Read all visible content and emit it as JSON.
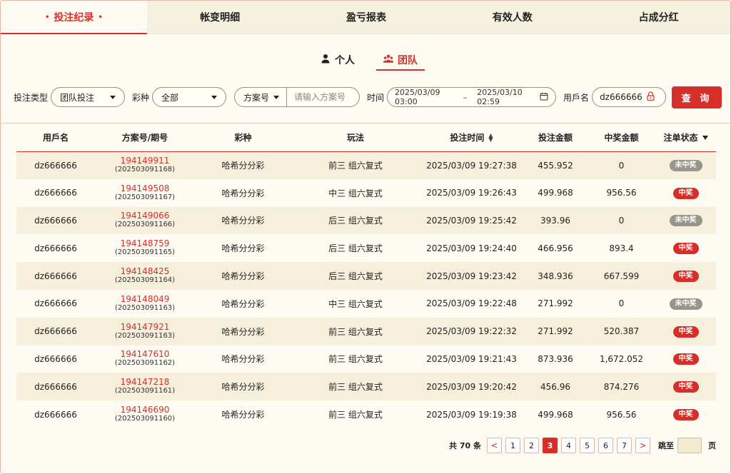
{
  "top_tabs": [
    {
      "label": "投注纪录",
      "active": true
    },
    {
      "label": "帐变明细",
      "active": false
    },
    {
      "label": "盈亏报表",
      "active": false
    },
    {
      "label": "有效人数",
      "active": false
    },
    {
      "label": "占成分红",
      "active": false
    }
  ],
  "top_tab_dot": "•",
  "sub_tabs": [
    {
      "label": "个人",
      "icon": "person-icon",
      "active": false
    },
    {
      "label": "团队",
      "icon": "team-icon",
      "active": true
    }
  ],
  "filters": {
    "bet_type_label": "投注类型",
    "bet_type_value": "团队投注",
    "lottery_label": "彩种",
    "lottery_value": "全部",
    "plan_select_value": "方案号",
    "plan_placeholder": "请输入方案号",
    "time_label": "时间",
    "date_start": "2025/03/09 03:00",
    "date_sep": "–",
    "date_end": "2025/03/10 02:59",
    "username_label": "用戶名",
    "username_value": "dz666666",
    "query_button": "查 询"
  },
  "table": {
    "headers": [
      "用戶名",
      "方案号/期号",
      "彩种",
      "玩法",
      "投注时间",
      "投注金额",
      "中奖金额",
      "注单状态"
    ],
    "rows": [
      {
        "user": "dz666666",
        "plan": "194149911",
        "period": "(202503091168)",
        "lottery": "哈希分分彩",
        "play": "前三 组六复式",
        "time": "2025/03/09 19:27:38",
        "bet": "455.952",
        "win": "0",
        "status": "未中奖",
        "status_type": "lose"
      },
      {
        "user": "dz666666",
        "plan": "194149508",
        "period": "(202503091167)",
        "lottery": "哈希分分彩",
        "play": "中三 组六复式",
        "time": "2025/03/09 19:26:43",
        "bet": "499.968",
        "win": "956.56",
        "status": "中奖",
        "status_type": "win"
      },
      {
        "user": "dz666666",
        "plan": "194149066",
        "period": "(202503091166)",
        "lottery": "哈希分分彩",
        "play": "后三 组六复式",
        "time": "2025/03/09 19:25:42",
        "bet": "393.96",
        "win": "0",
        "status": "未中奖",
        "status_type": "lose"
      },
      {
        "user": "dz666666",
        "plan": "194148759",
        "period": "(202503091165)",
        "lottery": "哈希分分彩",
        "play": "后三 组六复式",
        "time": "2025/03/09 19:24:40",
        "bet": "466.956",
        "win": "893.4",
        "status": "中奖",
        "status_type": "win"
      },
      {
        "user": "dz666666",
        "plan": "194148425",
        "period": "(202503091164)",
        "lottery": "哈希分分彩",
        "play": "后三 组六复式",
        "time": "2025/03/09 19:23:42",
        "bet": "348.936",
        "win": "667.599",
        "status": "中奖",
        "status_type": "win"
      },
      {
        "user": "dz666666",
        "plan": "194148049",
        "period": "(202503091163)",
        "lottery": "哈希分分彩",
        "play": "中三 组六复式",
        "time": "2025/03/09 19:22:48",
        "bet": "271.992",
        "win": "0",
        "status": "未中奖",
        "status_type": "lose"
      },
      {
        "user": "dz666666",
        "plan": "194147921",
        "period": "(202503091163)",
        "lottery": "哈希分分彩",
        "play": "前三 组六复式",
        "time": "2025/03/09 19:22:32",
        "bet": "271.992",
        "win": "520.387",
        "status": "中奖",
        "status_type": "win"
      },
      {
        "user": "dz666666",
        "plan": "194147610",
        "period": "(202503091162)",
        "lottery": "哈希分分彩",
        "play": "前三 组六复式",
        "time": "2025/03/09 19:21:43",
        "bet": "873.936",
        "win": "1,672.052",
        "status": "中奖",
        "status_type": "win"
      },
      {
        "user": "dz666666",
        "plan": "194147218",
        "period": "(202503091161)",
        "lottery": "哈希分分彩",
        "play": "前三 组六复式",
        "time": "2025/03/09 19:20:42",
        "bet": "456.96",
        "win": "874.276",
        "status": "中奖",
        "status_type": "win"
      },
      {
        "user": "dz666666",
        "plan": "194146690",
        "period": "(202503091160)",
        "lottery": "哈希分分彩",
        "play": "前三 组六复式",
        "time": "2025/03/09 19:19:38",
        "bet": "499.968",
        "win": "956.56",
        "status": "中奖",
        "status_type": "win"
      }
    ]
  },
  "pagination": {
    "total": "共 70 条",
    "prev": "<",
    "next": ">",
    "pages": [
      "1",
      "2",
      "3",
      "4",
      "5",
      "6",
      "7"
    ],
    "current": "3",
    "jump_label": "跳至",
    "page_suffix": "页"
  },
  "colors": {
    "accent": "#d62f2a",
    "background": "#fdfbf2",
    "lose_badge": "#9a958c"
  }
}
